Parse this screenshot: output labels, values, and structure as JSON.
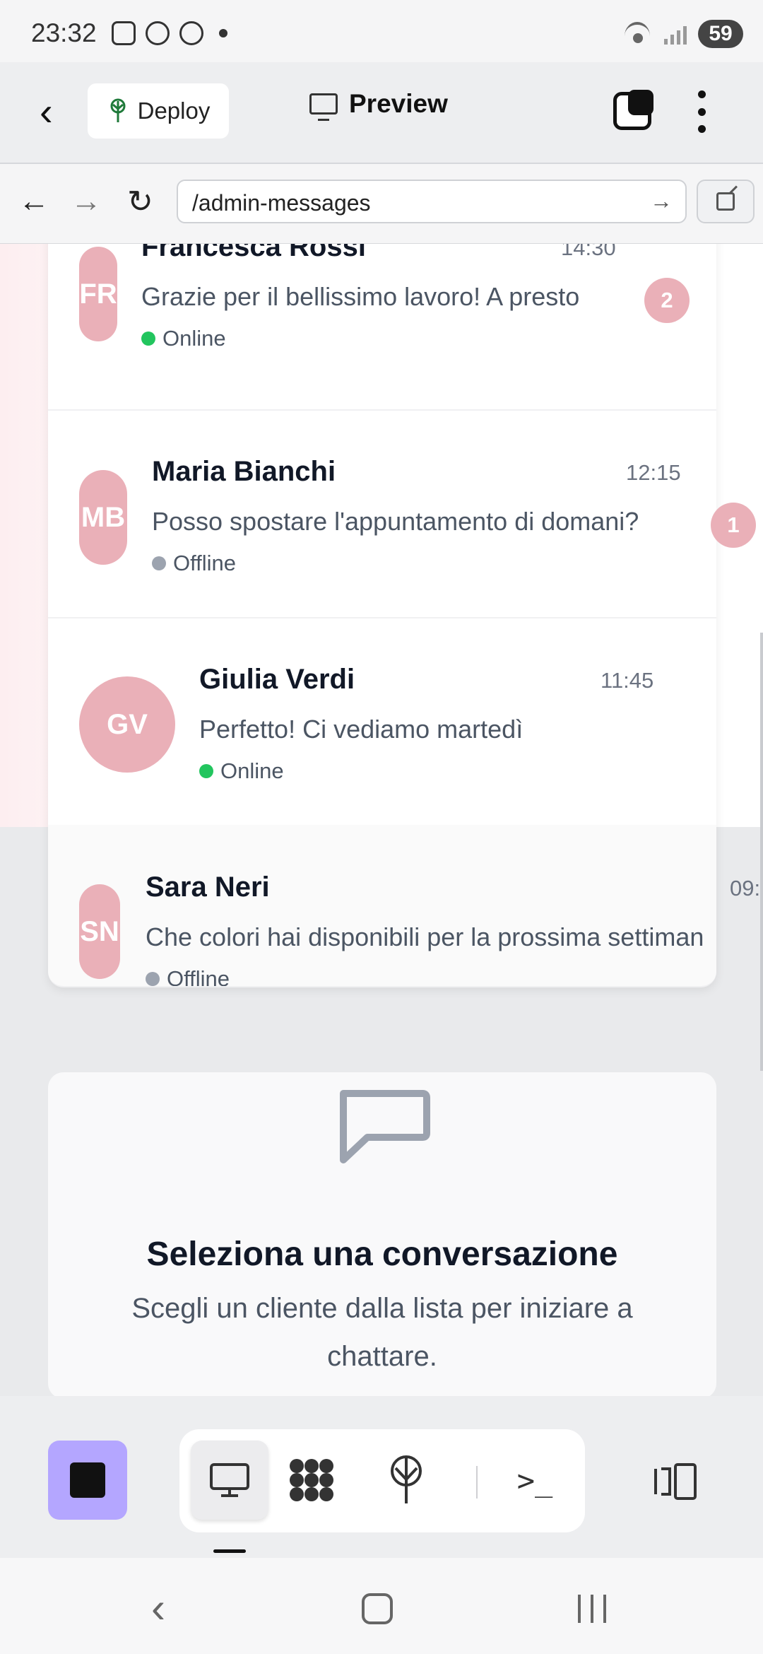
{
  "status_bar": {
    "time": "23:32",
    "battery": "59"
  },
  "header": {
    "deploy_label": "Deploy",
    "preview_label": "Preview"
  },
  "url_bar": {
    "url": "/admin-messages"
  },
  "conversations": [
    {
      "initials": "FR",
      "name": "Francesca Rossi",
      "time": "14:30",
      "message": "Grazie per il bellissimo lavoro! A presto",
      "status": "Online",
      "unread": "2"
    },
    {
      "initials": "MB",
      "name": "Maria Bianchi",
      "time": "12:15",
      "message": "Posso spostare l'appuntamento di domani?",
      "status": "Offline",
      "unread": "1"
    },
    {
      "initials": "GV",
      "name": "Giulia Verdi",
      "time": "11:45",
      "message": "Perfetto! Ci vediamo martedì",
      "status": "Online"
    },
    {
      "initials": "SN",
      "name": "Sara Neri",
      "time": "09:",
      "message": "Che colori hai disponibili per la prossima settiman",
      "status": "Offline"
    }
  ],
  "empty_state": {
    "title": "Seleziona una conversazione",
    "subtitle": "Scegli un cliente dalla lista per iniziare a chattare."
  },
  "colors": {
    "accent_pink": "#eab0b8",
    "online": "#22c55e",
    "offline": "#9ca3af",
    "stop_button": "#b4a6ff"
  },
  "icons": [
    "back-icon",
    "deploy-tree-icon",
    "monitor-icon",
    "tabs-icon",
    "more-icon",
    "arrow-back-icon",
    "arrow-forward-icon",
    "reload-icon",
    "open-external-icon",
    "chat-bubble-icon",
    "stop-icon",
    "grid-icon",
    "terminal-icon",
    "panel-icon"
  ]
}
